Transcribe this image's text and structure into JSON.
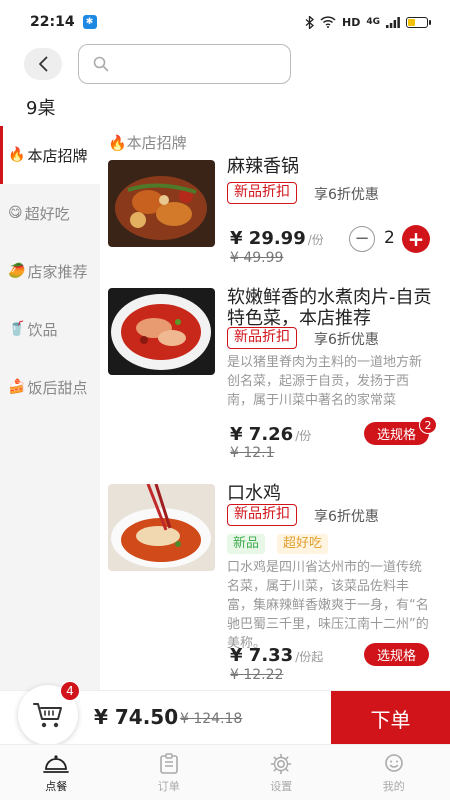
{
  "status_bar": {
    "time": "22:14",
    "network": "HD",
    "signal": "4G"
  },
  "colors": {
    "accent": "#d0141a",
    "new_tag_bg": "#e8f7e8",
    "new_tag_fg": "#3fae4f",
    "good_tag_bg": "#fff4e0",
    "good_tag_fg": "#e0a030"
  },
  "header": {
    "search_placeholder": "",
    "table_label": "9桌"
  },
  "sidebar": {
    "items": [
      {
        "emoji": "🔥",
        "label": "本店招牌"
      },
      {
        "emoji": "😋",
        "label": "超好吃"
      },
      {
        "emoji": "🥭",
        "label": "店家推荐"
      },
      {
        "emoji": "🥤",
        "label": "饮品"
      },
      {
        "emoji": "🍰",
        "label": "饭后甜点"
      }
    ]
  },
  "menu": {
    "section_title": "🔥本店招牌",
    "dishes": [
      {
        "name": "麻辣香锅",
        "discount_tag": "新品折扣",
        "discount_text": "享6折优惠",
        "price": "¥ 29.99",
        "unit": "/份",
        "orig_price": "¥ 49.99",
        "qty": "2",
        "minus": "−",
        "plus": "+"
      },
      {
        "name": "软嫩鲜香的水煮肉片-自贡特色菜，本店推荐",
        "discount_tag": "新品折扣",
        "discount_text": "享6折优惠",
        "desc": "是以猪里脊肉为主料的一道地方新创名菜，起源于自贡，发扬于西南，属于川菜中著名的家常菜",
        "price": "¥ 7.26",
        "unit": "/份",
        "orig_price": "¥ 12.1",
        "spec_label": "选规格",
        "spec_badge": "2"
      },
      {
        "name": "口水鸡",
        "discount_tag": "新品折扣",
        "discount_text": "享6折优惠",
        "tag_new": "新品",
        "tag_good": "超好吃",
        "desc": "口水鸡是四川省达州市的一道传统名菜，属于川菜，该菜品佐料丰富，集麻辣鲜香嫩爽于一身，有“名驰巴蜀三千里，味压江南十二州”的美称。",
        "price": "¥ 7.33",
        "unit": "/份起",
        "orig_price": "¥ 12.22",
        "spec_label": "选规格"
      }
    ]
  },
  "cart": {
    "count": "4",
    "total": "¥ 74.50",
    "orig_total": "¥ 124.18",
    "checkout_label": "下单"
  },
  "tabbar": {
    "tabs": [
      {
        "label": "点餐"
      },
      {
        "label": "订单"
      },
      {
        "label": "设置"
      },
      {
        "label": "我的"
      }
    ]
  }
}
